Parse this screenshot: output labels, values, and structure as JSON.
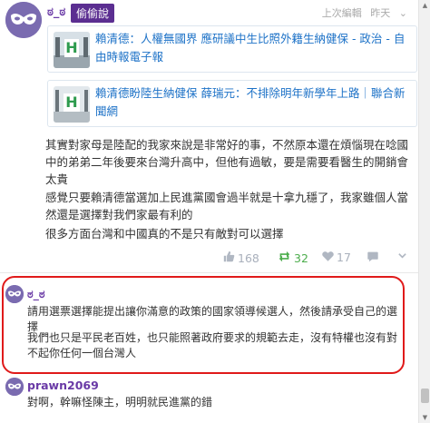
{
  "post": {
    "author": "ಠ_ಠ",
    "flair": "偷偷說",
    "meta_edit": "上次編輯",
    "meta_time": "昨天",
    "links": [
      {
        "title": "賴清德：人權無國界 應研議中生比照外籍生納健保 - 政治 - 自由時報電子報"
      },
      {
        "title": "賴清德盼陸生納健保 薛瑞元：不排除明年新學年上路｜聯合新聞網"
      }
    ],
    "paragraphs": [
      "其實對家母是陸配的我家來說是非常好的事，不然原本還在煩惱現在唸國中的弟弟二年後要來台灣升高中，但他有過敏，要是需要看醫生的開銷會太貴",
      "感覺只要賴清德當選加上民進黨國會過半就是十拿九穩了，我家雖個人當然還是選擇對我們家最有利的",
      "很多方面台灣和中國真的不是只有敵對可以選擇"
    ],
    "actions": {
      "likes": "168",
      "shares": "32",
      "hearts": "17"
    }
  },
  "replies": [
    {
      "author": "ಠ_ಠ",
      "lines": [
        "請用選票選擇能提出讓你滿意的政策的國家領導候選人，然後請承受自己的選擇",
        "我們也只是平民老百姓，也只能照著政府要求的規範去走，沒有特權也沒有對不起你任何一個台灣人"
      ]
    },
    {
      "author": "prawn2069",
      "lines": [
        "對啊，幹嘛怪陳主，明明就民進黨的錯"
      ]
    }
  ],
  "colors": {
    "accent": "#6a3aa6",
    "flair_bg": "#5b2e91",
    "link": "#1d72c7",
    "highlight": "#e01a1a",
    "share_green": "#4cad4c"
  },
  "icons": {
    "avatar": "mask-avatar-icon",
    "share": "retweet-icon",
    "like": "thumbs-up-icon",
    "heart": "heart-icon",
    "menu": "chevron-down-icon"
  }
}
